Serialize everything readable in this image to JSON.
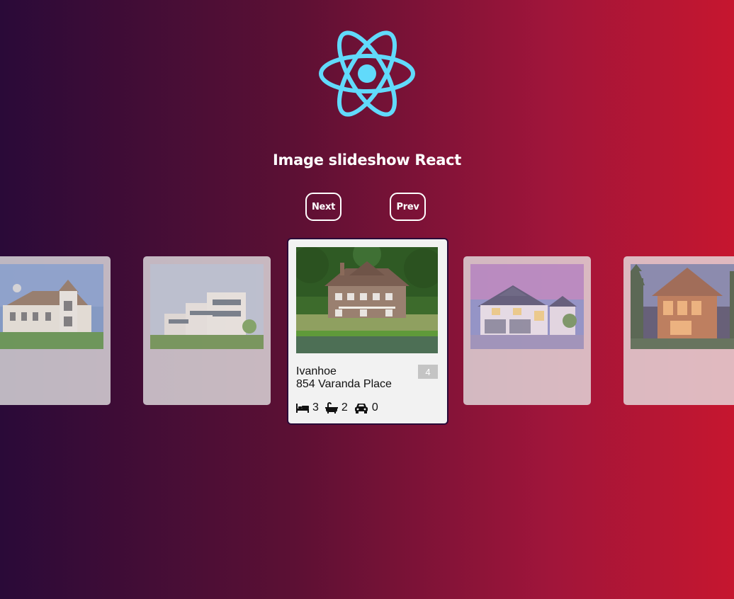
{
  "header": {
    "logo_icon": "react-atom-icon",
    "logo_color": "#61dafb",
    "title": "Image slideshow React"
  },
  "nav": {
    "next_label": "Next",
    "prev_label": "Prev"
  },
  "slides": [
    {
      "photo": "white-villa-photo"
    },
    {
      "photo": "modern-white-building-photo"
    },
    {
      "photo": "brown-house-by-pond-photo",
      "name": "Ivanhoe",
      "address": "854 Varanda Place",
      "index": "4",
      "features": [
        {
          "icon": "bed-icon",
          "value": "3"
        },
        {
          "icon": "bathtub-icon",
          "value": "2"
        },
        {
          "icon": "car-icon",
          "value": "0"
        }
      ]
    },
    {
      "photo": "suburban-house-dusk-photo"
    },
    {
      "photo": "wooden-modern-house-photo"
    }
  ],
  "colors": {
    "gradient_start": "#2a0a38",
    "gradient_end": "#c6162f",
    "active_card_bg": "#f2f2f2",
    "badge_bg": "#c4c4c4"
  }
}
